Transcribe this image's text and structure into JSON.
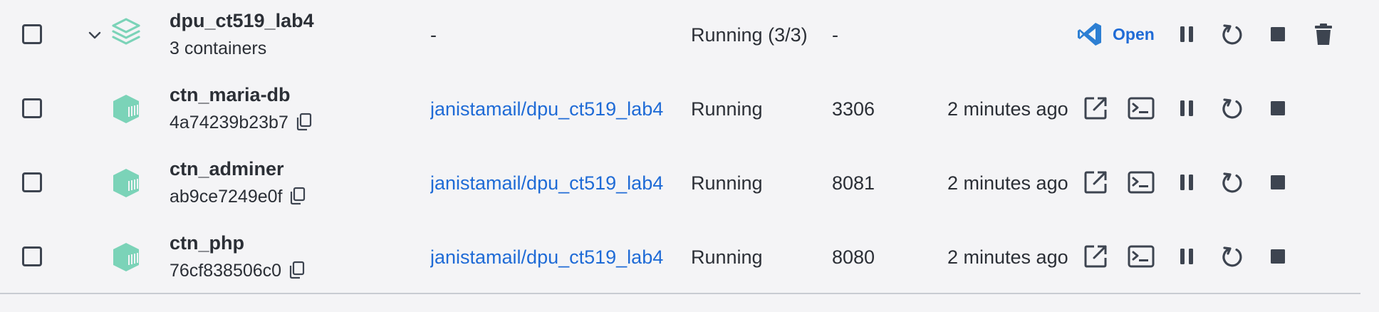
{
  "group": {
    "name": "dpu_ct519_lab4",
    "subtitle": "3 containers",
    "image": "-",
    "status": "Running (3/3)",
    "port": "-",
    "open_label": "Open",
    "icons": [
      "chevron-down-icon",
      "stack-icon",
      "vscode-icon",
      "pause-icon",
      "restart-icon",
      "stop-icon",
      "delete-icon"
    ]
  },
  "containers": [
    {
      "name": "ctn_maria-db",
      "id": "4a74239b23b7",
      "image": "janistamail/dpu_ct519_lab4",
      "status": "Running",
      "port": "3306",
      "started": "2 minutes ago"
    },
    {
      "name": "ctn_adminer",
      "id": "ab9ce7249e0f",
      "image": "janistamail/dpu_ct519_lab4",
      "status": "Running",
      "port": "8081",
      "started": "2 minutes ago"
    },
    {
      "name": "ctn_php",
      "id": "76cf838506c0",
      "image": "janistamail/dpu_ct519_lab4",
      "status": "Running",
      "port": "8080",
      "started": "2 minutes ago"
    }
  ],
  "container_icons": [
    "container-cube-icon",
    "copy-icon",
    "open-browser-icon",
    "terminal-icon",
    "pause-icon",
    "restart-icon",
    "stop-icon"
  ],
  "colors": {
    "accent": "#1f6bd6",
    "container_green": "#7bd3b8",
    "icon_dark": "#3d4450",
    "background": "#f4f4f6"
  }
}
